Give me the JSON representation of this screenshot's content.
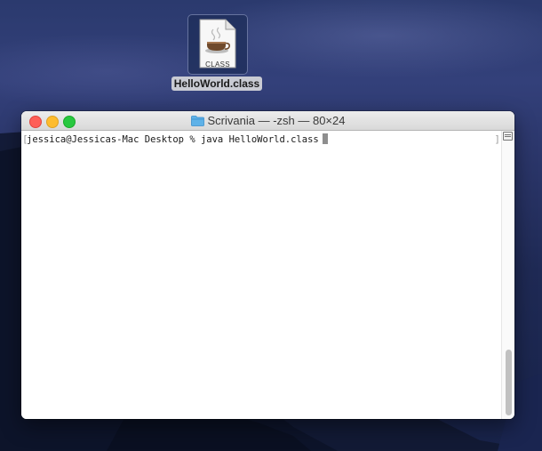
{
  "desktop": {
    "file_icon": {
      "name": "HelloWorld.class",
      "badge": "CLASS",
      "icon": "java-coffee-cup-icon"
    }
  },
  "window": {
    "title": "Scrivania — -zsh — 80×24",
    "title_icon": "folder-icon",
    "buttons": {
      "close_color": "#fe5f57",
      "minimize_color": "#febc2e",
      "maximize_color": "#28c840"
    },
    "terminal": {
      "prompt": "jessica@Jessicas-Mac Desktop % ",
      "command": "java HelloWorld.class"
    }
  }
}
